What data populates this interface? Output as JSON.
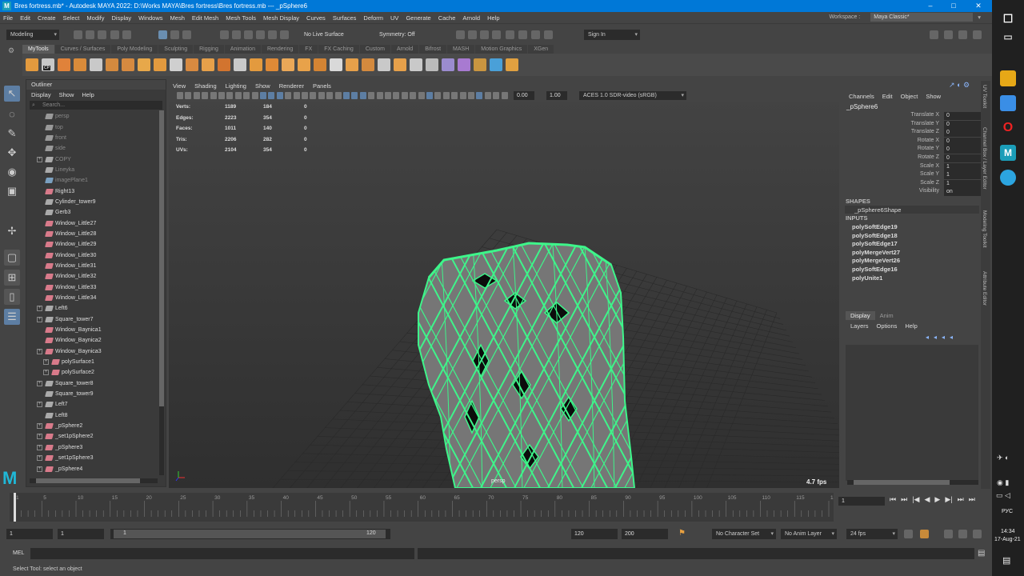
{
  "window": {
    "title": "Bres fortress.mb* - Autodesk MAYA 2022: D:\\Works MAYA\\Bres fortress\\Bres fortress.mb  ---  _pSphere6",
    "logo": "M",
    "minimize": "–",
    "maximize": "□",
    "close": "✕"
  },
  "menubar": [
    "File",
    "Edit",
    "Create",
    "Select",
    "Modify",
    "Display",
    "Windows",
    "Mesh",
    "Edit Mesh",
    "Mesh Tools",
    "Mesh Display",
    "Curves",
    "Surfaces",
    "Deform",
    "UV",
    "Generate",
    "Cache",
    "Arnold",
    "Help"
  ],
  "workspace": {
    "label": "Workspace :",
    "value": "Maya Classic*"
  },
  "statusline": {
    "mode": "Modeling",
    "live_surface": "No Live Surface",
    "symmetry": "Symmetry: Off",
    "signin": "Sign In"
  },
  "shelf_tabs": [
    "MyTools",
    "Curves / Surfaces",
    "Poly Modeling",
    "Sculpting",
    "Rigging",
    "Animation",
    "Rendering",
    "FX",
    "FX Caching",
    "Custom",
    "Arnold",
    "Bifrost",
    "MASH",
    "Motion Graphics",
    "XGen"
  ],
  "shelf_colors": [
    "#e39a3e",
    "#c9c9c9",
    "#e0823a",
    "#d98b3a",
    "#c9c9c9",
    "#d48a3e",
    "#d68a40",
    "#e7a84a",
    "#e39a3e",
    "#cfcfcf",
    "#d88a40",
    "#e6a04a",
    "#d2742f",
    "#c9c9c9",
    "#e39a3e",
    "#df8a36",
    "#eaa858",
    "#e8a24a",
    "#d48433",
    "#d9d9d9",
    "#e6a04a",
    "#d48a3e",
    "#c9c9c9",
    "#e6a04a",
    "#c9c9c9",
    "#bbbbbb",
    "#9b8ccf",
    "#a87ad1",
    "#c99540",
    "#4aa0d8",
    "#e0a040"
  ],
  "shelf_badge": "CP",
  "outliner": {
    "title": "Outliner",
    "menus": [
      "Display",
      "Show",
      "Help"
    ],
    "search_placeholder": "Search...",
    "items": [
      {
        "label": "persp",
        "type": "camera",
        "dim": true,
        "exp": false,
        "indent": 0
      },
      {
        "label": "top",
        "type": "camera",
        "dim": true,
        "exp": false,
        "indent": 0
      },
      {
        "label": "front",
        "type": "camera",
        "dim": true,
        "exp": false,
        "indent": 0
      },
      {
        "label": "side",
        "type": "camera",
        "dim": true,
        "exp": false,
        "indent": 0
      },
      {
        "label": "COPY",
        "type": "group",
        "dim": true,
        "exp": true,
        "indent": 0
      },
      {
        "label": "Lineyka",
        "type": "group",
        "dim": true,
        "exp": false,
        "indent": 0
      },
      {
        "label": "imagePlane1",
        "type": "image",
        "dim": true,
        "exp": false,
        "indent": 0
      },
      {
        "label": "Right13",
        "type": "mesh",
        "dim": false,
        "exp": false,
        "indent": 0
      },
      {
        "label": "Cylinder_tower9",
        "type": "group",
        "dim": false,
        "exp": false,
        "indent": 0
      },
      {
        "label": "Gerb3",
        "type": "group",
        "dim": false,
        "exp": false,
        "indent": 0
      },
      {
        "label": "Window_Little27",
        "type": "mesh",
        "dim": false,
        "exp": false,
        "indent": 0
      },
      {
        "label": "Window_Little28",
        "type": "mesh",
        "dim": false,
        "exp": false,
        "indent": 0
      },
      {
        "label": "Window_Little29",
        "type": "mesh",
        "dim": false,
        "exp": false,
        "indent": 0
      },
      {
        "label": "Window_Little30",
        "type": "mesh",
        "dim": false,
        "exp": false,
        "indent": 0
      },
      {
        "label": "Window_Little31",
        "type": "mesh",
        "dim": false,
        "exp": false,
        "indent": 0
      },
      {
        "label": "Window_Little32",
        "type": "mesh",
        "dim": false,
        "exp": false,
        "indent": 0
      },
      {
        "label": "Window_Little33",
        "type": "mesh",
        "dim": false,
        "exp": false,
        "indent": 0
      },
      {
        "label": "Window_Little34",
        "type": "mesh",
        "dim": false,
        "exp": false,
        "indent": 0
      },
      {
        "label": "Left6",
        "type": "group",
        "dim": false,
        "exp": true,
        "indent": 0
      },
      {
        "label": "Square_tower7",
        "type": "group",
        "dim": false,
        "exp": true,
        "indent": 0
      },
      {
        "label": "Window_Baynica1",
        "type": "mesh",
        "dim": false,
        "exp": false,
        "indent": 0
      },
      {
        "label": "Window_Baynica2",
        "type": "mesh",
        "dim": false,
        "exp": false,
        "indent": 0
      },
      {
        "label": "Window_Baynica3",
        "type": "mesh",
        "dim": false,
        "exp": true,
        "indent": 0
      },
      {
        "label": "polySurface1",
        "type": "mesh",
        "dim": false,
        "exp": true,
        "indent": 1
      },
      {
        "label": "polySurface2",
        "type": "mesh",
        "dim": false,
        "exp": true,
        "indent": 1
      },
      {
        "label": "Square_tower8",
        "type": "group",
        "dim": false,
        "exp": true,
        "indent": 0
      },
      {
        "label": "Square_tower9",
        "type": "group",
        "dim": false,
        "exp": false,
        "indent": 0
      },
      {
        "label": "Left7",
        "type": "group",
        "dim": false,
        "exp": true,
        "indent": 0
      },
      {
        "label": "Left8",
        "type": "group",
        "dim": false,
        "exp": false,
        "indent": 0
      },
      {
        "label": "_pSphere2",
        "type": "mesh",
        "dim": false,
        "exp": true,
        "indent": 0
      },
      {
        "label": "_set1pSphere2",
        "type": "mesh",
        "dim": false,
        "exp": true,
        "indent": 0
      },
      {
        "label": "_pSphere3",
        "type": "mesh",
        "dim": false,
        "exp": true,
        "indent": 0
      },
      {
        "label": "_set1pSphere3",
        "type": "mesh",
        "dim": false,
        "exp": true,
        "indent": 0
      },
      {
        "label": "_pSphere4",
        "type": "mesh",
        "dim": false,
        "exp": true,
        "indent": 0
      }
    ]
  },
  "viewport": {
    "menus": [
      "View",
      "Shading",
      "Lighting",
      "Show",
      "Renderer",
      "Panels"
    ],
    "exposure": "0.00",
    "gamma": "1.00",
    "colorspace": "ACES 1.0 SDR-video (sRGB)",
    "hud": [
      {
        "name": "Verts:",
        "a": "1189",
        "b": "184",
        "c": "0"
      },
      {
        "name": "Edges:",
        "a": "2223",
        "b": "354",
        "c": "0"
      },
      {
        "name": "Faces:",
        "a": "1011",
        "b": "140",
        "c": "0"
      },
      {
        "name": "Tris:",
        "a": "2206",
        "b": "282",
        "c": "0"
      },
      {
        "name": "UVs:",
        "a": "2104",
        "b": "354",
        "c": "0"
      }
    ],
    "camera": "persp",
    "fps": "4.7 fps"
  },
  "channelbox": {
    "menus": [
      "Channels",
      "Edit",
      "Object",
      "Show"
    ],
    "object": "_pSphere6",
    "attrs": [
      {
        "name": "Translate X",
        "value": "0"
      },
      {
        "name": "Translate Y",
        "value": "0"
      },
      {
        "name": "Translate Z",
        "value": "0"
      },
      {
        "name": "Rotate X",
        "value": "0"
      },
      {
        "name": "Rotate Y",
        "value": "0"
      },
      {
        "name": "Rotate Z",
        "value": "0"
      },
      {
        "name": "Scale X",
        "value": "1"
      },
      {
        "name": "Scale Y",
        "value": "1"
      },
      {
        "name": "Scale Z",
        "value": "1"
      },
      {
        "name": "Visibility",
        "value": "on"
      }
    ],
    "shapes_label": "SHAPES",
    "shape": "_pSphere6Shape",
    "inputs_label": "INPUTS",
    "inputs": [
      "polySoftEdge19",
      "polySoftEdge18",
      "polySoftEdge17",
      "polyMergeVert27",
      "polyMergeVert26",
      "polySoftEdge16",
      "polyUnite1"
    ]
  },
  "layer_editor": {
    "tabs": [
      "Display",
      "Anim"
    ],
    "menus": [
      "Layers",
      "Options",
      "Help"
    ]
  },
  "side_tabs": [
    "UV Toolkit",
    "Channel Box / Layer Editor",
    "Modeling Toolkit",
    "Attribute Editor"
  ],
  "timeline": {
    "ticks": [
      "1",
      "5",
      "10",
      "15",
      "20",
      "25",
      "30",
      "35",
      "40",
      "45",
      "50",
      "55",
      "60",
      "65",
      "70",
      "75",
      "80",
      "85",
      "90",
      "95",
      "100",
      "105",
      "110",
      "115",
      "120"
    ],
    "current": "1"
  },
  "playback": [
    "⏮",
    "⏭",
    "|◀",
    "◀",
    "▶",
    "▶|",
    "⏭",
    "⏭"
  ],
  "range": {
    "start": "1",
    "start2": "1",
    "slider_start": "1",
    "slider_end": "120",
    "end": "120",
    "end2": "200",
    "char_set": "No Character Set",
    "anim_layer": "No Anim Layer",
    "fps": "24 fps"
  },
  "mel": {
    "label": "MEL"
  },
  "helpline": "Select Tool: select an object",
  "taskbar": {
    "lang": "РУС",
    "time": "14:34",
    "date": "17-Aug-21"
  }
}
